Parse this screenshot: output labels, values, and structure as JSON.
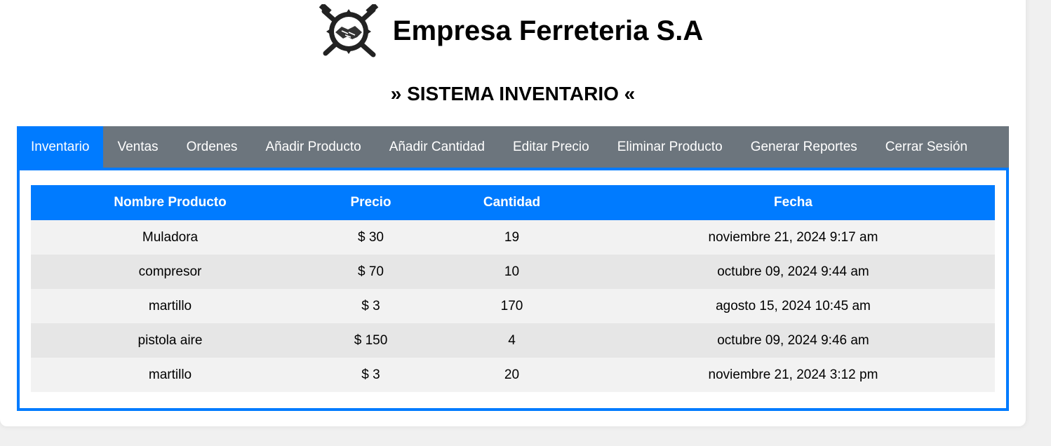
{
  "header": {
    "logo_icon": "handshake-tools-logo-icon",
    "company_name": "Empresa Ferreteria S.A",
    "subtitle": "» SISTEMA INVENTARIO «"
  },
  "nav": {
    "active_color": "#007bff",
    "bar_color": "#6c757d",
    "items": [
      {
        "label": "Inventario",
        "active": true
      },
      {
        "label": "Ventas"
      },
      {
        "label": "Ordenes"
      },
      {
        "label": "Añadir Producto"
      },
      {
        "label": "Añadir Cantidad"
      },
      {
        "label": "Editar Precio"
      },
      {
        "label": "Eliminar Producto"
      },
      {
        "label": "Generar Reportes"
      },
      {
        "label": "Cerrar Sesión"
      }
    ]
  },
  "table": {
    "headers": [
      "Nombre Producto",
      "Precio",
      "Cantidad",
      "Fecha"
    ],
    "rows": [
      [
        "Muladora",
        "$ 30",
        "19",
        "noviembre 21, 2024 9:17 am"
      ],
      [
        "compresor",
        "$ 70",
        "10",
        "octubre 09, 2024 9:44 am"
      ],
      [
        "martillo",
        "$ 3",
        "170",
        "agosto 15, 2024 10:45 am"
      ],
      [
        "pistola aire",
        "$ 150",
        "4",
        "octubre 09, 2024 9:46 am"
      ],
      [
        "martillo",
        "$ 3",
        "20",
        "noviembre 21, 2024 3:12 pm"
      ]
    ]
  }
}
